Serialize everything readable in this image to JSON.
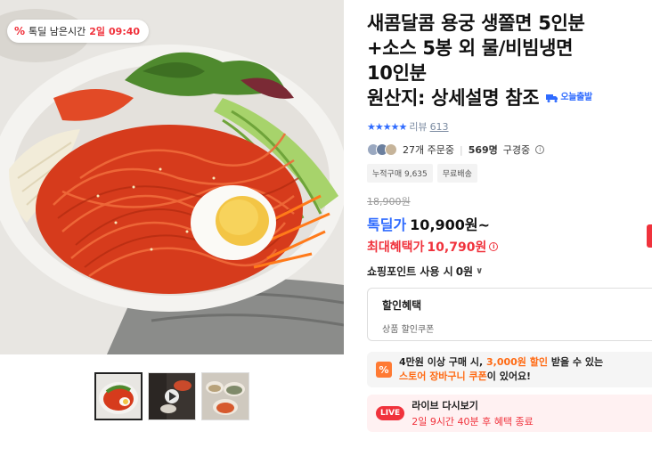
{
  "deal_badge": {
    "icon": "percent-icon",
    "label": "톡딜 남은시간",
    "days": "2일",
    "time": "09:40"
  },
  "product": {
    "title_lines": [
      "새콤달콤 용궁 생쫄면 5인분",
      "+소스 5봉 외 물/비빔냉면",
      "10인분"
    ],
    "origin": "원산지: 상세설명 참조",
    "delivery_badge": "오늘출발"
  },
  "rating": {
    "stars": "★★★★★",
    "review_label": "리뷰",
    "review_count": "613"
  },
  "subscriptions": {
    "orders": "27개 주문중",
    "members": "569명",
    "members_label": "구경중"
  },
  "tags": [
    "누적구매 9,635",
    "무료배송"
  ],
  "price": {
    "original": "18,900원",
    "deal_label": "톡딜가",
    "deal_price": "10,900원~",
    "max_benefit_label": "최대혜택가",
    "max_benefit_price": "10,790원"
  },
  "points": {
    "label": "쇼핑포인트 사용 시",
    "value": "0원"
  },
  "discount": {
    "title": "할인혜택",
    "sub": "상품 할인쿠폰"
  },
  "coupon": {
    "icon": "coupon-percent-icon",
    "text_1": "4만원 이상 구매 시,",
    "highlight_amount": "3,000원 할인",
    "text_2": "받을 수 있는",
    "highlight_coupon": "스토어 장바구니 쿠폰",
    "text_3": "이 있어요!"
  },
  "live": {
    "badge": "LIVE",
    "title": "라이브 다시보기",
    "sub": "2일 9시간 40분 후 혜택 종료"
  },
  "colors": {
    "accent_blue": "#2f6bff",
    "accent_red": "#f0323c",
    "accent_orange": "#ff6a13"
  }
}
